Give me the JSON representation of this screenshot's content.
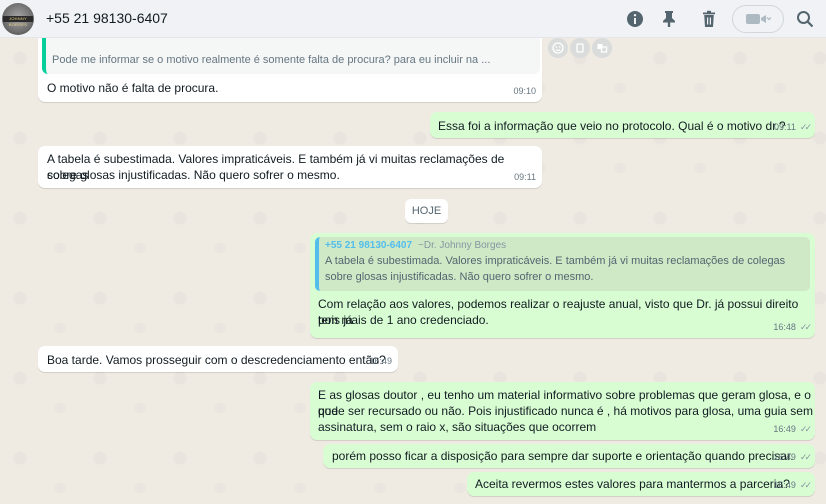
{
  "header": {
    "avatar_text": "JOHNNY BORGES",
    "contact": "+55 21 98130-6407",
    "icons": [
      "info-icon",
      "pin-icon",
      "trash-icon",
      "video-icon",
      "search-icon"
    ]
  },
  "messages": {
    "m1": {
      "quoted": "Pode me informar se o motivo realmente é somente falta de procura? para eu incluir na ...",
      "text": "O motivo não é falta de procura.",
      "time": "09:10"
    },
    "m2": {
      "text": "Essa foi a informação que veio no protocolo. Qual é o motivo dr.?",
      "time": "09:11",
      "ticks": "✓✓"
    },
    "m3": {
      "line1": "A tabela é subestimada. Valores impraticáveis. E também já vi muitas reclamações de colegas",
      "line2": "sobre glosas injustificadas. Não quero sofrer o mesmo.",
      "time": "09:11"
    },
    "day": "HOJE",
    "m4": {
      "quoted_number": "+55 21 98130-6407",
      "quoted_sender": "~Dr. Johnny Borges",
      "quoted_line1": "A tabela é subestimada. Valores impraticáveis. E também já vi muitas reclamações de colegas",
      "quoted_line2": "sobre glosas injustificadas. Não quero sofrer o mesmo.",
      "line1": "Com relação aos valores, podemos realizar o reajuste anual, visto que Dr. já possui direito pois já",
      "line2": "tem mais de 1 ano credenciado.",
      "time": "16:48",
      "ticks": "✓✓"
    },
    "m5": {
      "text": "Boa tarde. Vamos prosseguir com o descredenciamento então?",
      "time": "16:49"
    },
    "m6": {
      "line1": "E as glosas doutor , eu tenho um material informativo sobre problemas que geram glosa, e o que",
      "line2": "pode ser recursado ou não. Pois injustificado nunca é , há motivos para glosa, uma guia sem",
      "line3": "assinatura, sem o raio x, são situações que ocorrem",
      "time": "16:49",
      "ticks": "✓✓"
    },
    "m7": {
      "text": "porém posso ficar a disposição para sempre dar suporte e orientação quando precisar.",
      "time": "16:49",
      "ticks": "✓✓"
    },
    "m8": {
      "text": "Aceita revermos estes valores para mantermos a parceria?",
      "time": "16:49",
      "ticks": "✓✓"
    }
  },
  "colors": {
    "incoming": "#ffffff",
    "outgoing": "#d9fdd3",
    "background": "#efeae2",
    "accent": "#06cf9c",
    "quote_bar": "#53bdeb"
  }
}
